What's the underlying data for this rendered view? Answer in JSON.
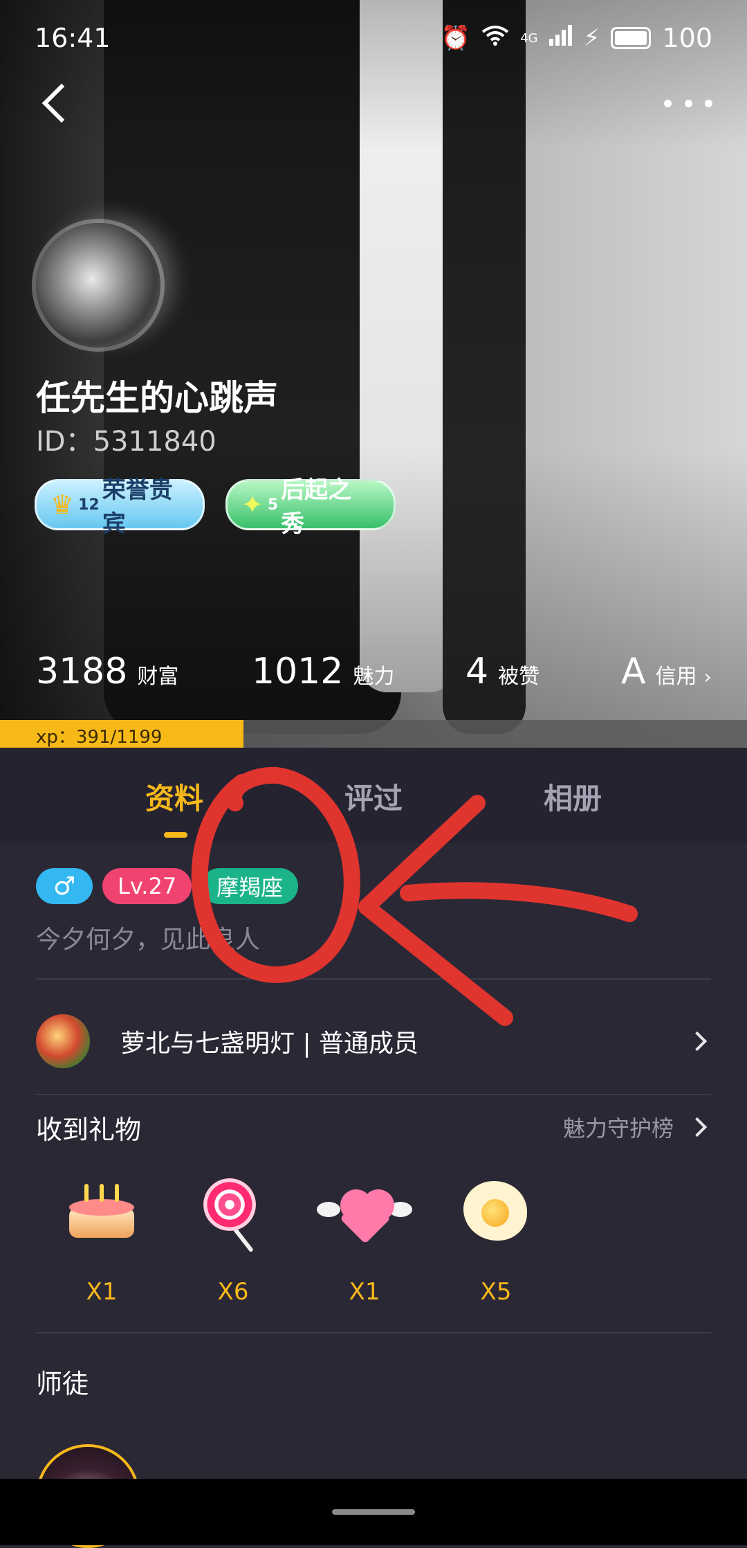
{
  "status_bar": {
    "time": "16:41",
    "network": "4G",
    "battery": "100"
  },
  "profile": {
    "username": "任先生的心跳声",
    "id_label": "ID：5311840",
    "badges": [
      {
        "level": "12",
        "label": "荣誉贵宾",
        "icon": "crown-icon"
      },
      {
        "level": "5",
        "label": "后起之秀",
        "icon": "star-hexagon-icon"
      }
    ],
    "stats": [
      {
        "value": "3188",
        "label": "财富"
      },
      {
        "value": "1012",
        "label": "魅力"
      },
      {
        "value": "4",
        "label": "被赞"
      },
      {
        "value": "A",
        "label": "信用"
      }
    ],
    "xp": {
      "text": "xp：391/1199",
      "current": 391,
      "max": 1199
    }
  },
  "tabs": [
    {
      "label": "资料",
      "active": true
    },
    {
      "label": "评过",
      "active": false
    },
    {
      "label": "相册",
      "active": false
    }
  ],
  "info": {
    "tags": [
      {
        "label": "♂",
        "color": "#33b8f2"
      },
      {
        "label": "Lv.27",
        "color": "#f0436f"
      },
      {
        "label": "摩羯座",
        "color": "#1ab38a"
      }
    ],
    "signature": "今夕何夕，见此良人",
    "club": "萝北与七盏明灯 | 普通成员"
  },
  "gifts": {
    "title": "收到礼物",
    "link": "魅力守护榜",
    "items": [
      {
        "name": "cake-icon",
        "count": "X1"
      },
      {
        "name": "lollipop-icon",
        "count": "X6"
      },
      {
        "name": "winged-heart-icon",
        "count": "X1"
      },
      {
        "name": "fried-egg-icon",
        "count": "X5"
      }
    ]
  },
  "master": {
    "title": "师徒"
  },
  "colors": {
    "accent": "#f7b91a",
    "background": "#2b2836",
    "annotation": "#e0342e"
  }
}
